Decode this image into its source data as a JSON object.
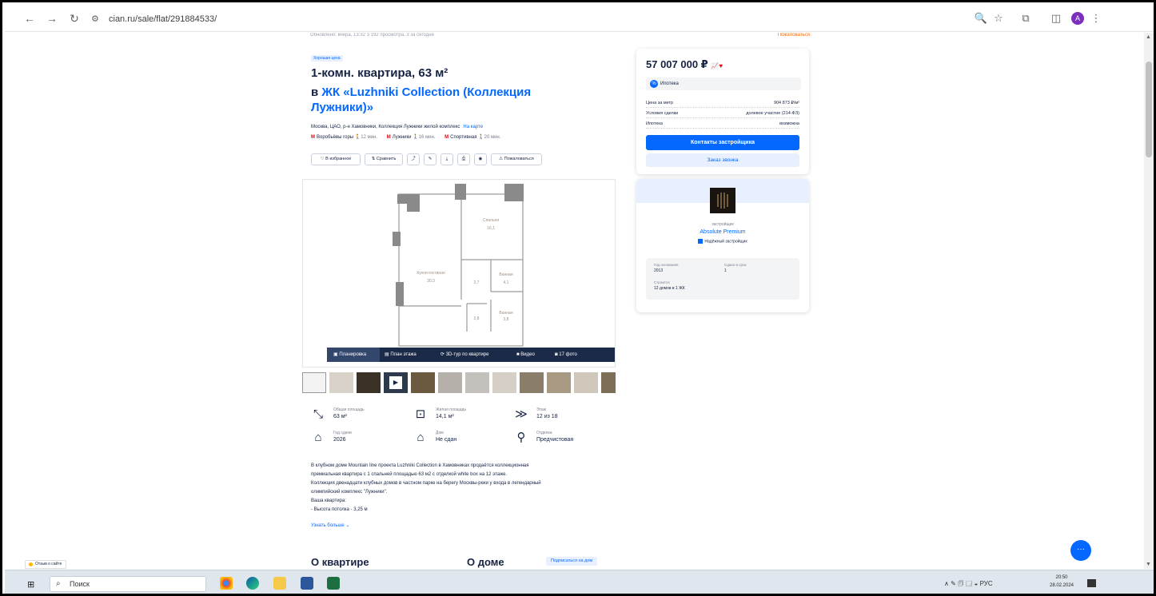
{
  "browser": {
    "url": "cian.ru/sale/flat/291884533/",
    "avatar_letter": "A"
  },
  "listing": {
    "meta_left": "Обновлено: вчера, 13:32    3 192 просмотра, 3 за сегодня",
    "meta_right": "Пожаловаться",
    "badge": "Хорошая цена",
    "title": "1-комн. квартира, 63 м²",
    "complex_prefix": "в ",
    "complex_name": "ЖК «Luzhniki Collection (Коллекция Лужники)»",
    "address": "Москва, ЦАО, р-н Хамовники, Коллекция Лужники жилой комплекс",
    "address_map": "На карте",
    "metro": [
      {
        "name": "Воробьёвы горы",
        "time": "12 мин."
      },
      {
        "name": "Лужники",
        "time": "16 мин."
      },
      {
        "name": "Спортивная",
        "time": "20 мин."
      }
    ],
    "actions": {
      "favorite": "В избранное",
      "compare": "Сравнить",
      "complain": "Пожаловаться"
    },
    "plan_tabs": {
      "layout": "Планировка",
      "floor_plan": "План этажа",
      "tour": "3D-тур по квартире",
      "video": "Видео",
      "photos": "17 фото"
    },
    "plan_rooms": {
      "bedroom": "Спальня",
      "bedroom_area": "16,1",
      "kitchen": "Кухня-гостиная",
      "kitchen_area": "30,3",
      "bath1": "Ванная",
      "bath1_area": "4,1",
      "bath2": "Ванная",
      "bath2_area": "3,8",
      "hall_area": "2,7",
      "closet_area": "2,8"
    },
    "params": [
      {
        "label": "Общая площадь",
        "value": "63 м²",
        "icon": "area-icon"
      },
      {
        "label": "Жилая площадь",
        "value": "14,1 м²",
        "icon": "living-area-icon"
      },
      {
        "label": "Этаж",
        "value": "12 из 18",
        "icon": "floor-icon"
      },
      {
        "label": "Год сдачи",
        "value": "2026",
        "icon": "building-icon"
      },
      {
        "label": "Дом",
        "value": "Не сдан",
        "icon": "house-icon"
      },
      {
        "label": "Отделка",
        "value": "Предчистовая",
        "icon": "finish-icon"
      }
    ],
    "description": [
      "В клубном доме Mountain line проекта Luzhniki Collection в Хамовниках продаётся коллекционная",
      "премиальная квартира с 1 спальней площадью 63 м2 с отделкой white box на 12 этаже.",
      "Коллекция двенадцати клубных домов в частном парке на берегу Москвы-реки у входа в легендарный",
      "олимпийский комплекс \"Лужники\".",
      "Ваша квартира:",
      "-     Высота потолка - 3,25 м"
    ],
    "show_more": "Узнать больше ⌄",
    "section_about_flat": "О квартире",
    "section_about_house": "О доме",
    "subscribe_house": "Подписаться на дом"
  },
  "price_card": {
    "price": "57 007 000 ₽",
    "mortgage": "Ипотека",
    "rows": [
      {
        "k": "Цена за метр",
        "v": "904 873 ₽/м²"
      },
      {
        "k": "Условия сделки",
        "v": "долевое участие (214-ФЗ)"
      },
      {
        "k": "Ипотека",
        "v": "возможна"
      }
    ],
    "contacts_btn": "Контакты застройщика",
    "callback_btn": "Заказ звонка"
  },
  "developer": {
    "role": "застройщик",
    "name": "Absolute Premium",
    "verified": "Надёжный застройщик",
    "stats": [
      {
        "k": "Год основания",
        "v": "2013"
      },
      {
        "k": "Сдано в срок",
        "v": "1"
      },
      {
        "k": "Строится",
        "v": "12 домов в 1 ЖК"
      }
    ]
  },
  "feedback": "Отзыв о сайте",
  "taskbar": {
    "search_placeholder": "Поиск",
    "lang": "РУС",
    "time": "20:50",
    "date": "28.02.2024"
  },
  "colors": {
    "accent": "#0468ff",
    "text": "#152242",
    "metro": "#e30613"
  }
}
